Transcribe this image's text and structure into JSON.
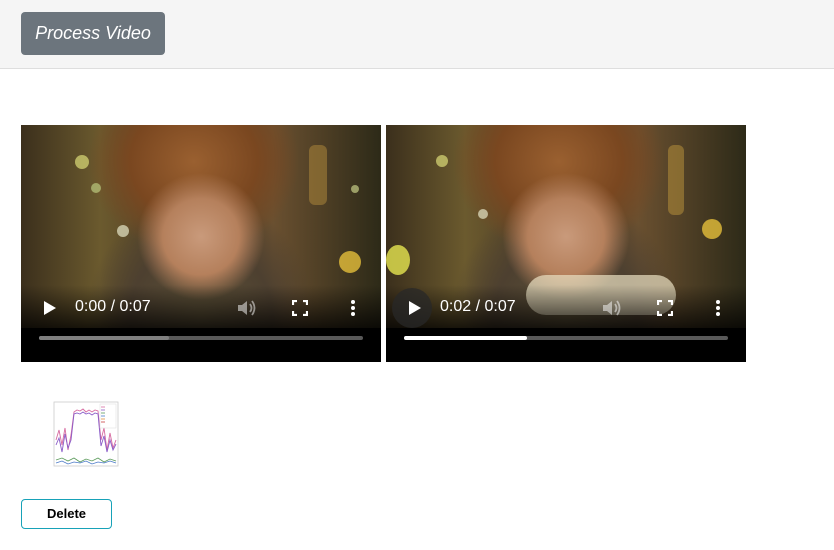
{
  "toolbar": {
    "process_label": "Process Video"
  },
  "videos": [
    {
      "time_display": "0:00 / 0:07",
      "progress": 0.4,
      "progress_color": "#7f7f7f",
      "play_highlight": false
    },
    {
      "time_display": "0:02 / 0:07",
      "progress": 0.38,
      "progress_color": "#ffffff",
      "play_highlight": true
    }
  ],
  "icons": [
    "play-icon",
    "volume-icon",
    "fullscreen-icon",
    "more-vert-icon"
  ],
  "actions": {
    "delete_label": "Delete"
  },
  "colors": {
    "process_button": "#6c757d",
    "delete_border": "#17a2b8"
  }
}
